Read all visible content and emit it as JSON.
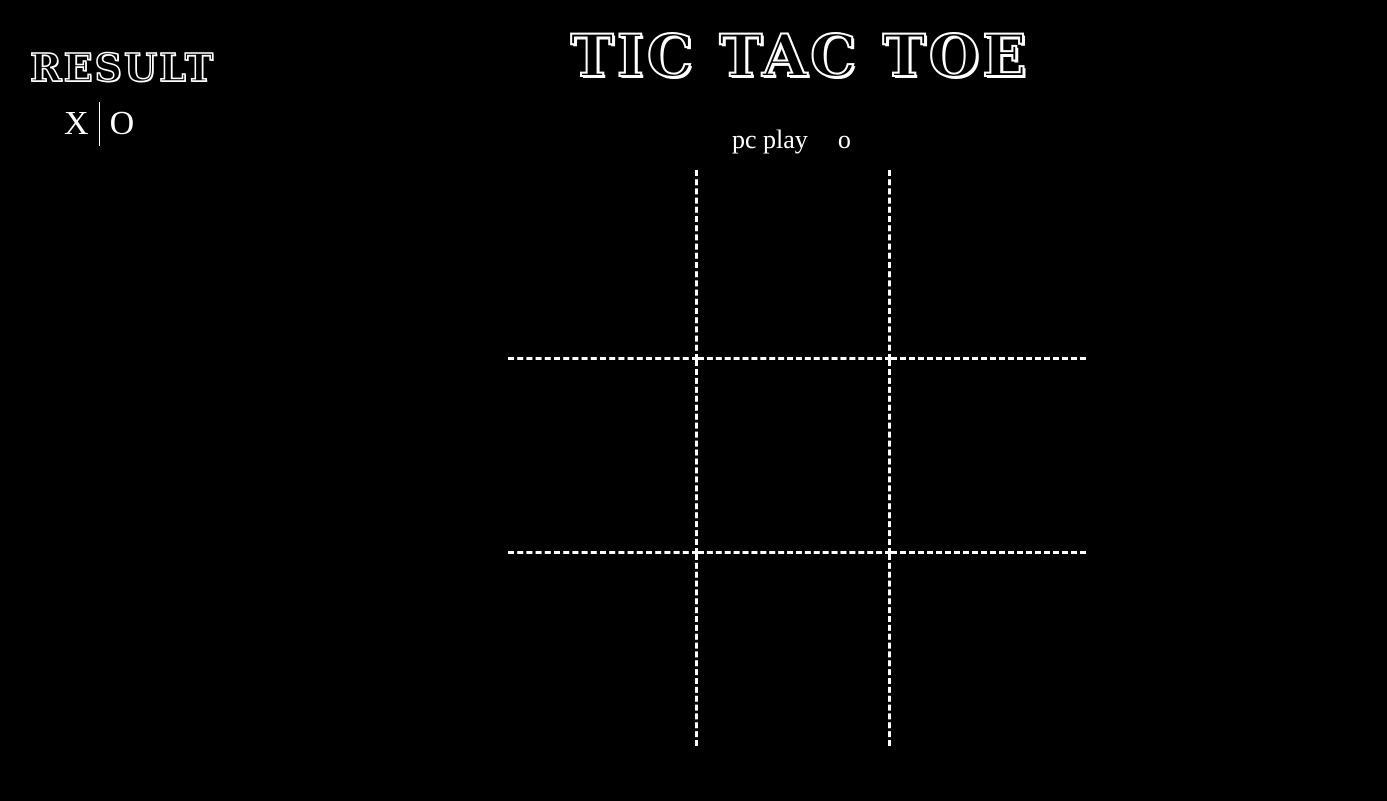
{
  "result": {
    "title": "RESULT",
    "x_label": "X",
    "o_label": "O"
  },
  "header": {
    "title": "TIC TAC TOE"
  },
  "status": {
    "text": "pc play",
    "symbol": "o"
  },
  "board": {
    "cells": [
      "",
      "",
      "",
      "",
      "",
      "",
      "",
      "",
      ""
    ]
  },
  "colors": {
    "background": "#000000",
    "foreground": "#ffffff"
  }
}
